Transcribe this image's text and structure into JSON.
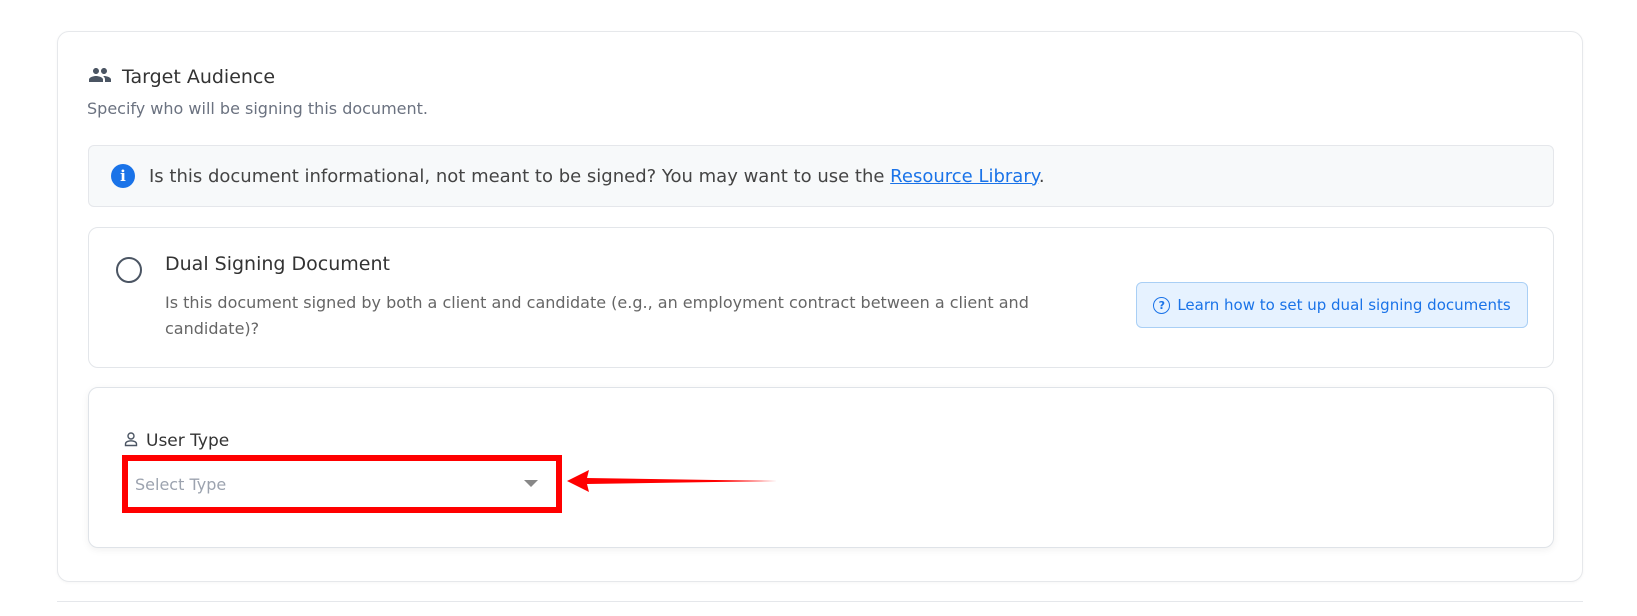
{
  "section": {
    "title": "Target Audience",
    "subtitle": "Specify who will be signing this document.",
    "icon": "people-icon"
  },
  "info": {
    "text": "Is this document informational, not meant to be signed? You may want to use the ",
    "link": "Resource Library",
    "suffix": ".",
    "icon": "info-icon"
  },
  "dual": {
    "title": "Dual Signing Document",
    "description": "Is this document signed by both a client and candidate (e.g., an employment contract between a client and candidate)?",
    "learn_button": "Learn how to set up dual signing documents",
    "selected": false
  },
  "user_type": {
    "label": "User Type",
    "placeholder": "Select Type",
    "icon": "person-icon"
  },
  "colors": {
    "accent": "#1a73e8",
    "highlight": "#ff0000"
  }
}
